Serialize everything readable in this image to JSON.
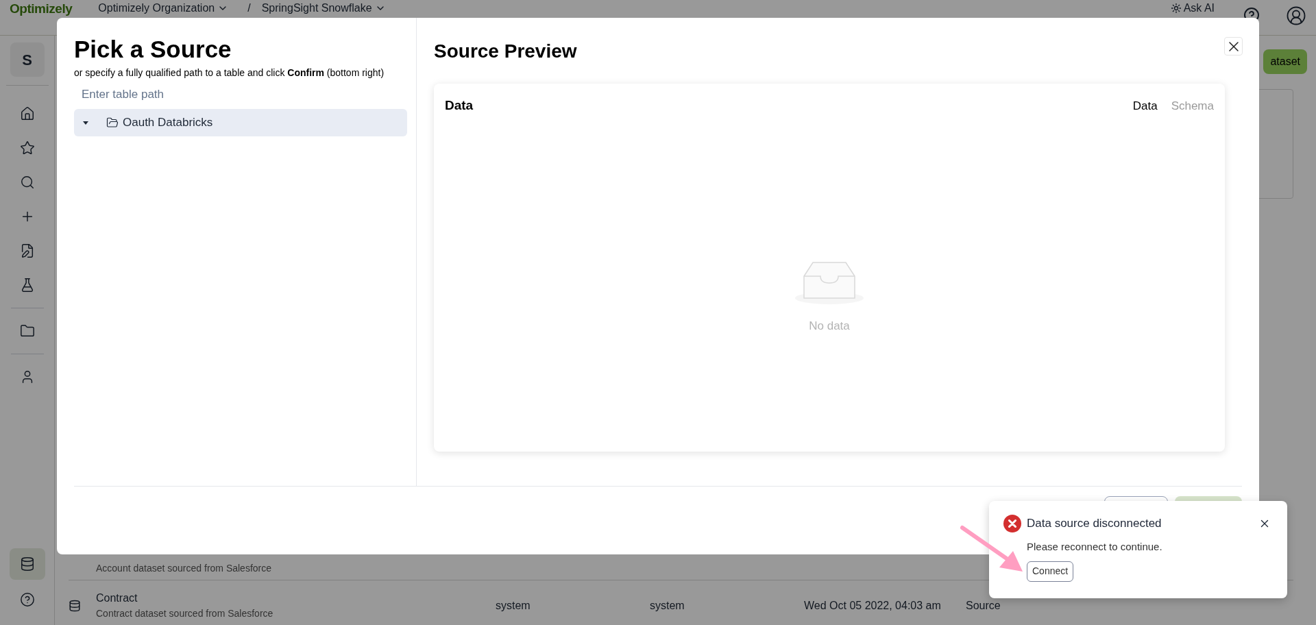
{
  "topbar": {
    "logo": "Optimizely",
    "organization": "Optimizely Organization",
    "separator": "/",
    "project": "SpringSight Snowflake",
    "ask_ai": "Ask AI"
  },
  "sidebar": {
    "workspace": "S",
    "nav": [
      {
        "selected": false
      },
      {
        "selected": false
      },
      {
        "selected": false
      },
      {
        "selected": false
      },
      {
        "selected": false
      },
      {
        "selected": false
      },
      {
        "selected": false
      },
      {
        "selected": false
      }
    ],
    "footer": [
      {
        "selected": true
      },
      {
        "selected": false
      }
    ]
  },
  "page": {
    "action_button": "ataset",
    "rows": [
      {
        "kind": "partial",
        "description": "Account dataset sourced from Salesforce"
      },
      {
        "kind": "full",
        "name": "Contract",
        "description": "Contract dataset sourced from Salesforce",
        "created_by": "system",
        "updated_by": "system",
        "date": "Wed Oct 05 2022, 04:03 am",
        "type": "Source"
      }
    ]
  },
  "modal": {
    "title": "Pick a Source",
    "subtitle": "or specify a fully qualified path to a table and click **Confirm** (bottom right)",
    "path_placeholder": "Enter table path",
    "tree": [
      {
        "label": "Oauth Databricks",
        "expanded": true,
        "selected": true
      }
    ],
    "preview_title": "Source Preview",
    "card_title": "Data",
    "tabs": [
      {
        "label": "Data",
        "selected": true
      },
      {
        "label": "Schema",
        "selected": false
      }
    ],
    "empty_text": "No data"
  },
  "toast": {
    "title": "Data source disconnected",
    "message": "Please reconnect to continue.",
    "button": "Connect"
  }
}
